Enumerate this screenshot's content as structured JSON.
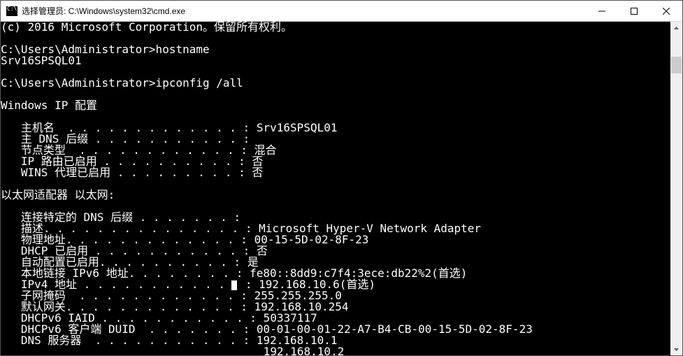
{
  "titlebar": {
    "icon_text": "C:\\.",
    "title": "选择管理员: C:\\Windows\\system32\\cmd.exe"
  },
  "terminal": {
    "lines": [
      "(c) 2016 Microsoft Corporation。保留所有权利。",
      "",
      "C:\\Users\\Administrator>hostname",
      "Srv16SPSQL01",
      "",
      "C:\\Users\\Administrator>ipconfig /all",
      "",
      "Windows IP 配置",
      "",
      "   主机名  . . . . . . . . . . . . . : Srv16SPSQL01",
      "   主 DNS 后缀 . . . . . . . . . . . :",
      "   节点类型  . . . . . . . . . . . . : 混合",
      "   IP 路由已启用 . . . . . . . . . . : 否",
      "   WINS 代理已启用 . . . . . . . . . : 否",
      "",
      "以太网适配器 以太网:",
      "",
      "   连接特定的 DNS 后缀 . . . . . . . :",
      "   描述. . . . . . . . . . . . . . . : Microsoft Hyper-V Network Adapter",
      "   物理地址. . . . . . . . . . . . . : 00-15-5D-02-8F-23",
      "   DHCP 已启用 . . . . . . . . . . . : 否",
      "   自动配置已启用. . . . . . . . . . : 是",
      "   本地链接 IPv6 地址. . . . . . . . : fe80::8dd9:c7f4:3ece:db22%2(首选)",
      "   IPv4 地址 . . . . . . . . . . . . : 192.168.10.6(首选)",
      "   子网掩码  . . . . . . . . . . . . : 255.255.255.0",
      "   默认网关. . . . . . . . . . . . . : 192.168.10.254",
      "   DHCPv6 IAID . . . . . . . . . . . : 50337117",
      "   DHCPv6 客户端 DUID  . . . . . . . : 00-01-00-01-22-A7-B4-CB-00-15-5D-02-8F-23",
      "   DNS 服务器  . . . . . . . . . . . : 192.168.10.1",
      "                                       192.168.10.2"
    ]
  }
}
